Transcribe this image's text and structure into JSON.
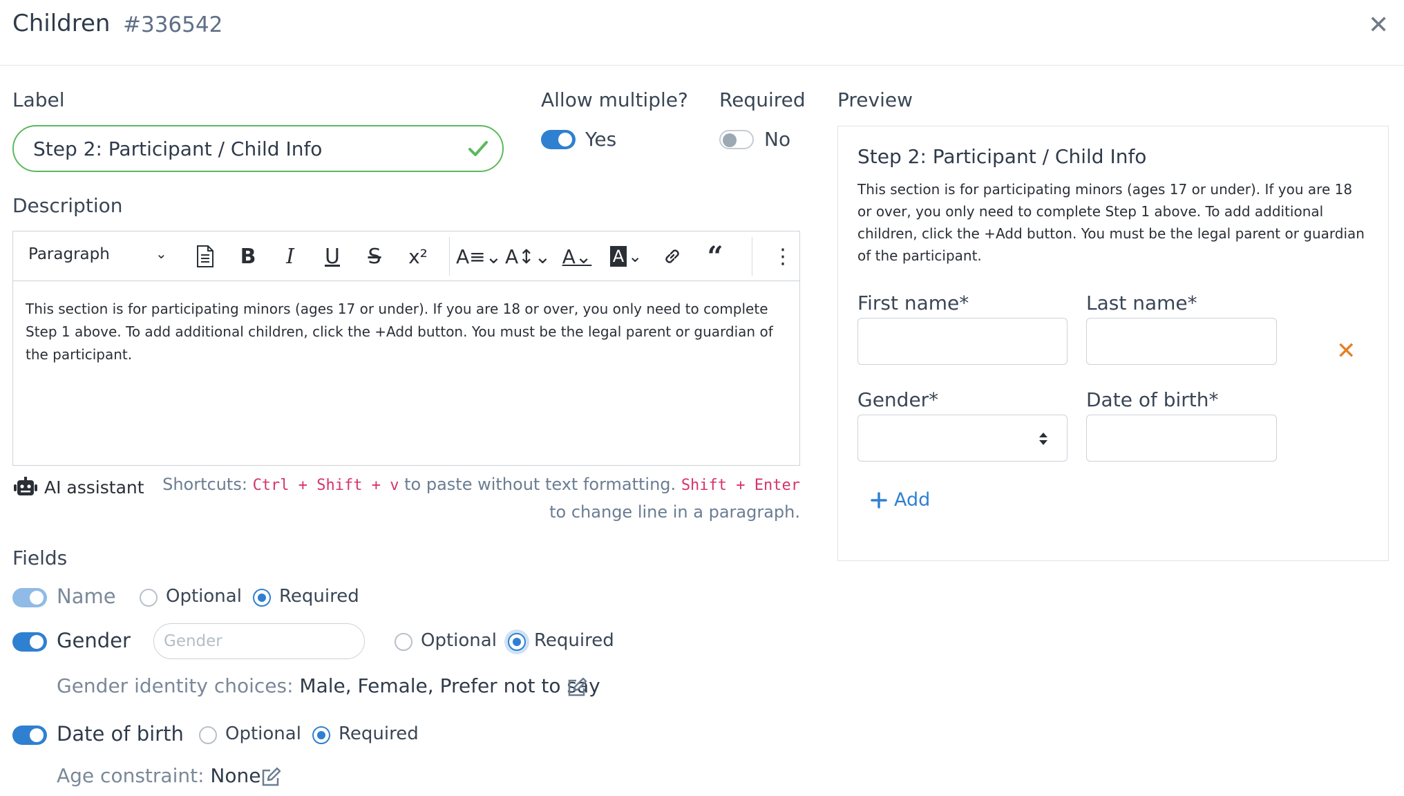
{
  "header": {
    "title": "Children",
    "id": "#336542",
    "close": "✕"
  },
  "label": {
    "title": "Label",
    "value": "Step 2: Participant / Child Info"
  },
  "allow_multiple": {
    "title": "Allow multiple?",
    "value": "Yes",
    "on": true
  },
  "required": {
    "title": "Required",
    "value": "No",
    "on": false
  },
  "description": {
    "title": "Description",
    "block_style": "Paragraph",
    "text": "This section is for participating minors (ages 17 or under). If you are 18 or over, you only need to complete Step 1 above. To add additional children, click the +Add button. You must be the legal parent or guardian of the participant."
  },
  "toolbar_icons": [
    "document-icon",
    "bold-icon",
    "italic-icon",
    "underline-icon",
    "strikethrough-icon",
    "superscript-icon",
    "font-size-icon",
    "line-height-icon",
    "font-color-icon",
    "highlight-color-icon",
    "link-icon",
    "quote-icon",
    "more-icon"
  ],
  "ai_assistant": "AI assistant",
  "shortcuts": {
    "prefix": "Shortcuts:",
    "key1": "Ctrl + Shift + v",
    "mid": "to paste without text formatting.",
    "key2": "Shift + Enter",
    "suffix": "to change line in a paragraph."
  },
  "fields": {
    "title": "Fields",
    "optional_label": "Optional",
    "required_label": "Required",
    "name": {
      "label": "Name",
      "enabled": true,
      "mode": "Required"
    },
    "gender": {
      "label": "Gender",
      "enabled": true,
      "placeholder": "Gender",
      "mode": "Required",
      "choices_label": "Gender identity choices:",
      "choices_value": "Male, Female, Prefer not to say"
    },
    "dob": {
      "label": "Date of birth",
      "enabled": true,
      "mode": "Required",
      "constraint_label": "Age constraint:",
      "constraint_value": "None"
    }
  },
  "preview": {
    "title": "Preview",
    "form_title": "Step 2: Participant / Child Info",
    "form_desc": "This section is for participating minors (ages 17 or under). If you are 18 or over, you only need to complete Step 1 above. To add additional children, click the +Add button. You must be the legal parent or guardian of the participant.",
    "first_name": "First name*",
    "last_name": "Last name*",
    "gender": "Gender*",
    "dob": "Date of birth*",
    "remove": "✕",
    "add": "Add"
  },
  "colors": {
    "accent": "#2f80d1",
    "success": "#5cb85c",
    "danger": "#e67e22",
    "code": "#d6336c"
  }
}
